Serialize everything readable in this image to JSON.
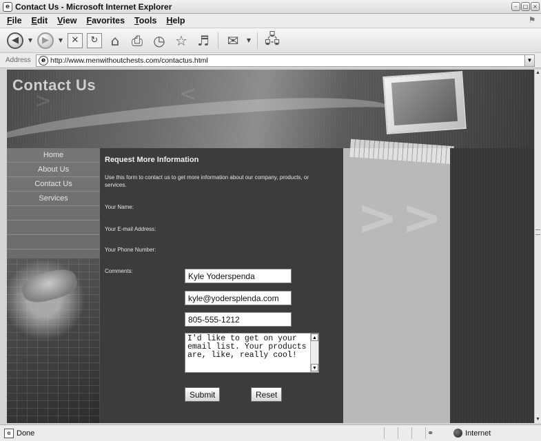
{
  "window": {
    "title": "Contact Us - Microsoft Internet Explorer",
    "controls": {
      "minimize": "–",
      "maximize": "□",
      "close": "×"
    }
  },
  "menu": [
    "File",
    "Edit",
    "View",
    "Favorites",
    "Tools",
    "Help"
  ],
  "toolbar": {
    "icons": [
      "back-icon",
      "forward-icon",
      "stop-icon",
      "refresh-icon",
      "home-icon",
      "print-icon",
      "history-icon",
      "favorites-icon",
      "media-icon",
      "mail-icon",
      "network-icon"
    ]
  },
  "address": {
    "label": "Address",
    "url": "http://www.menwithoutchests.com/contactus.html"
  },
  "page": {
    "banner_title": "Contact Us",
    "nav": [
      "Home",
      "About Us",
      "Contact Us",
      "Services"
    ],
    "section_title": "Request More Information",
    "intro": "Use this form to contact us to get more information about our company, products, or services.",
    "form": {
      "name_label": "Your Name:",
      "name_value": "Kyle Yoderspenda",
      "email_label": "Your E-mail Address:",
      "email_value": "kyle@yodersplenda.com",
      "phone_label": "Your Phone Number:",
      "phone_value": "805-555-1212",
      "comments_label": "Comments:",
      "comments_value": "I'd like to get on your email list. Your products are, like, really cool!",
      "submit_label": "Submit",
      "reset_label": "Reset"
    }
  },
  "status": {
    "text": "Done",
    "zone": "Internet"
  }
}
